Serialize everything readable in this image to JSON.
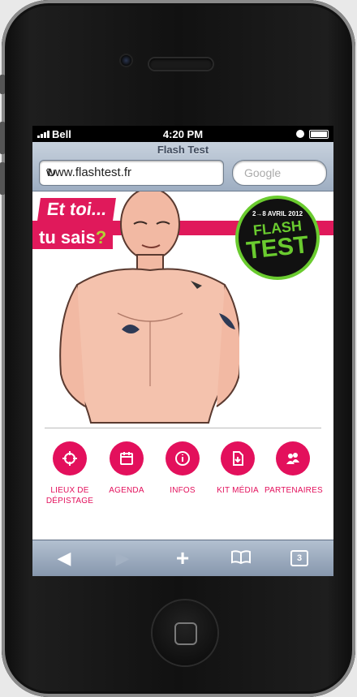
{
  "status": {
    "carrier": "Bell",
    "time": "4:20 PM"
  },
  "browser": {
    "page_title": "Flash Test",
    "url": "www.flashtest.fr",
    "search_placeholder": "Google"
  },
  "hero": {
    "line1": "Et toi...",
    "line2": "tu sais",
    "line2_mark": "?",
    "logo_date": "2→8 AVRIL 2012",
    "logo_flash": "FLASH",
    "logo_test": "TEST"
  },
  "menu": {
    "items": [
      {
        "label": "LIEUX DE DÉPISTAGE",
        "icon": "crosshair-icon"
      },
      {
        "label": "AGENDA",
        "icon": "calendar-icon"
      },
      {
        "label": "INFOS",
        "icon": "info-icon"
      },
      {
        "label": "KIT MÉDIA",
        "icon": "download-document-icon"
      },
      {
        "label": "PARTENAIRES",
        "icon": "people-icon"
      }
    ]
  },
  "toolbar": {
    "tabs_count": "3"
  },
  "colors": {
    "brand_pink": "#e3105c",
    "brand_green": "#6acb2f",
    "toolbar_blue": "#8797ad"
  }
}
